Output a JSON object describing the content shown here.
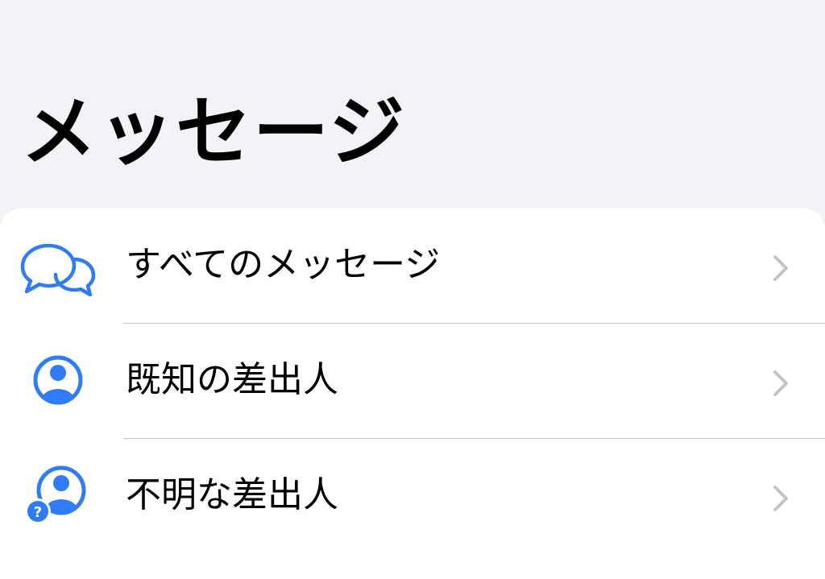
{
  "title": "メッセージ",
  "accent_color": "#2f7cf6",
  "rows": [
    {
      "label": "すべてのメッセージ",
      "icon": "speech-bubbles-icon"
    },
    {
      "label": "既知の差出人",
      "icon": "person-circle-icon"
    },
    {
      "label": "不明な差出人",
      "icon": "person-question-icon"
    }
  ]
}
